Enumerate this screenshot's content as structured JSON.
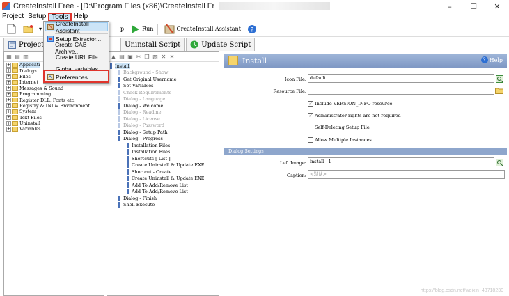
{
  "window": {
    "title": "CreateInstall Free - [D:\\Program Files (x86)\\CreateInstall Fr",
    "minimize": "–",
    "maximize": "☐",
    "close": "✕"
  },
  "menu": [
    "Project",
    "Setup",
    "Tools",
    "Help"
  ],
  "toolbar": {
    "run_label": "Run",
    "assistant_label": "CreateInstall Assistant"
  },
  "dropdown": {
    "items": [
      {
        "label": "CreateInstall Assistant",
        "icon": "assistant-icon"
      },
      {
        "label": "Setup Extractor...",
        "icon": "extractor-icon"
      },
      {
        "label": "Create CAB Archive...",
        "icon": ""
      },
      {
        "label": "Create URL File...",
        "icon": ""
      },
      {
        "label": "Global variables...",
        "icon": ""
      },
      {
        "label": "Preferences...",
        "icon": "preferences-icon"
      }
    ]
  },
  "tabs": [
    {
      "label": "Project",
      "icon": "project-icon"
    },
    {
      "label": "Uninstall Script",
      "icon": "uninstall-icon"
    },
    {
      "label": "Update Script",
      "icon": "update-icon"
    }
  ],
  "left_tree": [
    "Applicati",
    "Dialogs",
    "Files",
    "Internet",
    "Messages & Sound",
    "Programming",
    "Register DLL, Fonts etc.",
    "Registry & INI & Environment",
    "System",
    "Text Files",
    "Uninstall",
    "Variables"
  ],
  "steps": [
    {
      "label": "Install",
      "indent": 0,
      "disabled": false
    },
    {
      "label": "Background - Show",
      "indent": 1,
      "disabled": true
    },
    {
      "label": "Get Original Username",
      "indent": 1,
      "disabled": false
    },
    {
      "label": "Set Variables",
      "indent": 1,
      "disabled": false
    },
    {
      "label": "Check Requirements",
      "indent": 1,
      "disabled": true
    },
    {
      "label": "Dialog - Language",
      "indent": 1,
      "disabled": true
    },
    {
      "label": "Dialog - Welcome",
      "indent": 1,
      "disabled": false
    },
    {
      "label": "Dialog - Readme",
      "indent": 1,
      "disabled": true
    },
    {
      "label": "Dialog - License",
      "indent": 1,
      "disabled": true
    },
    {
      "label": "Dialog - Password",
      "indent": 1,
      "disabled": true
    },
    {
      "label": "Dialog - Setup Path",
      "indent": 1,
      "disabled": false
    },
    {
      "label": "Dialog - Progress",
      "indent": 1,
      "disabled": false
    },
    {
      "label": "Installation Files",
      "indent": 2,
      "disabled": false
    },
    {
      "label": "Installation Files",
      "indent": 2,
      "disabled": false
    },
    {
      "label": "Shortcuts [ List ]",
      "indent": 2,
      "disabled": false
    },
    {
      "label": "Create Uninstall & Update EXE",
      "indent": 2,
      "disabled": false
    },
    {
      "label": "Shortcut - Create",
      "indent": 2,
      "disabled": false
    },
    {
      "label": "Create Uninstall & Update EXE",
      "indent": 2,
      "disabled": false
    },
    {
      "label": "Add To Add/Remove List",
      "indent": 2,
      "disabled": false
    },
    {
      "label": "Add To Add/Remove List",
      "indent": 2,
      "disabled": false
    },
    {
      "label": "Dialog - Finish",
      "indent": 1,
      "disabled": false
    },
    {
      "label": "Shell Execute",
      "indent": 1,
      "disabled": false
    }
  ],
  "panel": {
    "title": "Install",
    "help_label": "Help",
    "icon_file_label": "Icon File:",
    "icon_file_value": "default",
    "resource_file_label": "Resource File:",
    "resource_file_value": "",
    "checkboxes": [
      {
        "label": "Include VERSION_INFO resource",
        "checked": true
      },
      {
        "label": "Administrator rights are not required",
        "checked": true
      },
      {
        "label": "Self-Deleting Setup File",
        "checked": false
      },
      {
        "label": "Allow Multiple Instances",
        "checked": false
      }
    ],
    "section_title": "Dialog Settings",
    "left_image_label": "Left Image:",
    "left_image_value": "install - 1",
    "caption_label": "Caption:",
    "caption_value": "<默认>"
  },
  "watermark": "https://blog.csdn.net/weixin_43718230"
}
